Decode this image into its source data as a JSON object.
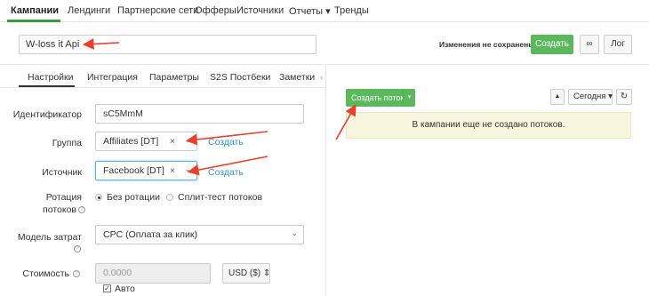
{
  "nav": {
    "items": [
      "Кампании",
      "Лендинги",
      "Партнерские сети",
      "Офферы",
      "Источники",
      "Отчеты ▾",
      "Тренды"
    ]
  },
  "header": {
    "campaign_name": "W-loss it Api",
    "unsaved_text": "Изменения не сохранены",
    "create_label": "Создать",
    "link_icon": "∞",
    "log_label": "Лог"
  },
  "tabs": [
    "Настройки",
    "Интеграция",
    "Параметры",
    "S2S Постбеки",
    "Заметки"
  ],
  "form": {
    "id_label": "Идентификатор",
    "id_value": "sC5MmM",
    "group_label": "Группа",
    "group_value": "Affiliates [DT]",
    "group_create": "Создать",
    "source_label": "Источник",
    "source_value": "Facebook [DT]",
    "source_create": "Создать",
    "rotation_label_1": "Ротация",
    "rotation_label_2": "потоков",
    "rotation_opt1": "Без ротации",
    "rotation_opt2": "Сплит-тест потоков",
    "cost_model_label": "Модель затрат",
    "cost_model_value": "CPC (Оплата за клик)",
    "cost_label": "Стоимость",
    "cost_value": "0.0000",
    "currency": "USD ($)",
    "auto_label": "Авто",
    "help": "?"
  },
  "streams": {
    "create_stream_label": "Создать поток",
    "date_filter": "Сегодня",
    "empty_message": "В кампании еще не создано потоков."
  },
  "colors": {
    "primary_green": "#5cb85c",
    "link_blue": "#3a8fc6",
    "annotation_red": "#e8402c"
  }
}
